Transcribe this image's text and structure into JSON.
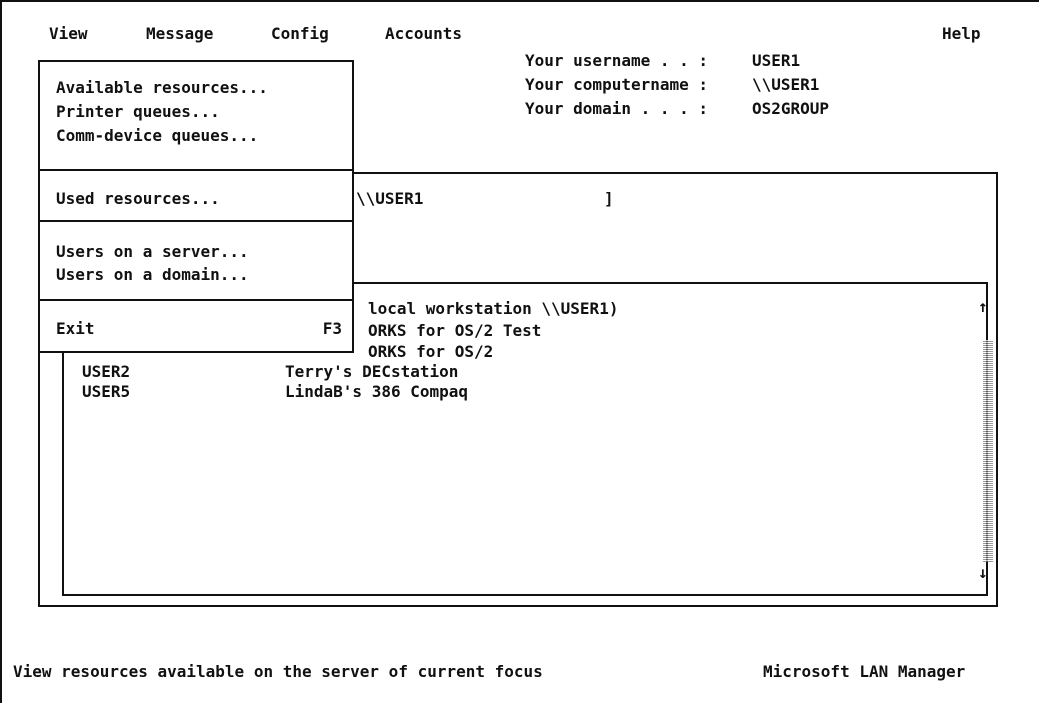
{
  "menubar": {
    "view": "View",
    "message": "Message",
    "config": "Config",
    "accounts": "Accounts",
    "help": "Help"
  },
  "info": {
    "username_label": "Your username . . :",
    "username": "USER1",
    "computername_label": "Your computername :",
    "computername": "\\\\USER1",
    "domain_label": "Your domain . . . :",
    "domain": "OS2GROUP"
  },
  "focus": {
    "server": "\\\\USER1",
    "bracket": "]"
  },
  "list": {
    "rows": [
      {
        "name": "",
        "comment": "local workstation \\\\USER1)"
      },
      {
        "name": "",
        "comment": "ORKS for OS/2 Test"
      },
      {
        "name": "",
        "comment": "ORKS for OS/2"
      },
      {
        "name": "USER2",
        "comment": "Terry's DECstation"
      },
      {
        "name": "USER5",
        "comment": "LindaB's 386 Compaq"
      }
    ],
    "scroll_up": "↑",
    "scroll_down": "↓"
  },
  "view_menu": {
    "items": [
      {
        "label": "Available resources..."
      },
      {
        "label": "Printer queues..."
      },
      {
        "label": "Comm-device queues..."
      },
      {
        "label": "Used resources..."
      },
      {
        "label": "Users on a server..."
      },
      {
        "label": "Users on a domain..."
      },
      {
        "label": "Exit",
        "hotkey": "F3"
      }
    ]
  },
  "status": {
    "hint": "View resources available on the server of current focus",
    "product": "Microsoft LAN Manager"
  }
}
